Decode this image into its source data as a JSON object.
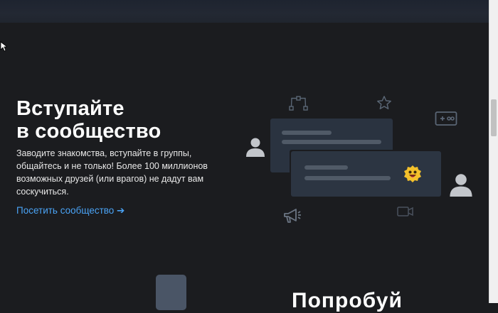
{
  "community": {
    "title_line1": "Вступайте",
    "title_line2": "в сообщество",
    "description": "Заводите знакомства, вступайте в группы, общайтесь и не только! Более 100 миллионов возможных друзей (или врагов) не дадут вам соскучиться.",
    "link_label": "Посетить сообщество ➔"
  },
  "next_section": {
    "title_partial": "Попробуй"
  },
  "icons": {
    "top": [
      "vector-pen-icon",
      "star-icon",
      "gamepad-icon"
    ],
    "side": [
      "user-avatar-icon",
      "megaphone-icon",
      "video-camera-icon",
      "emoji-icon"
    ]
  },
  "colors": {
    "background": "#1b1c1f",
    "link": "#4aa3f5",
    "card": "#2a3340"
  }
}
